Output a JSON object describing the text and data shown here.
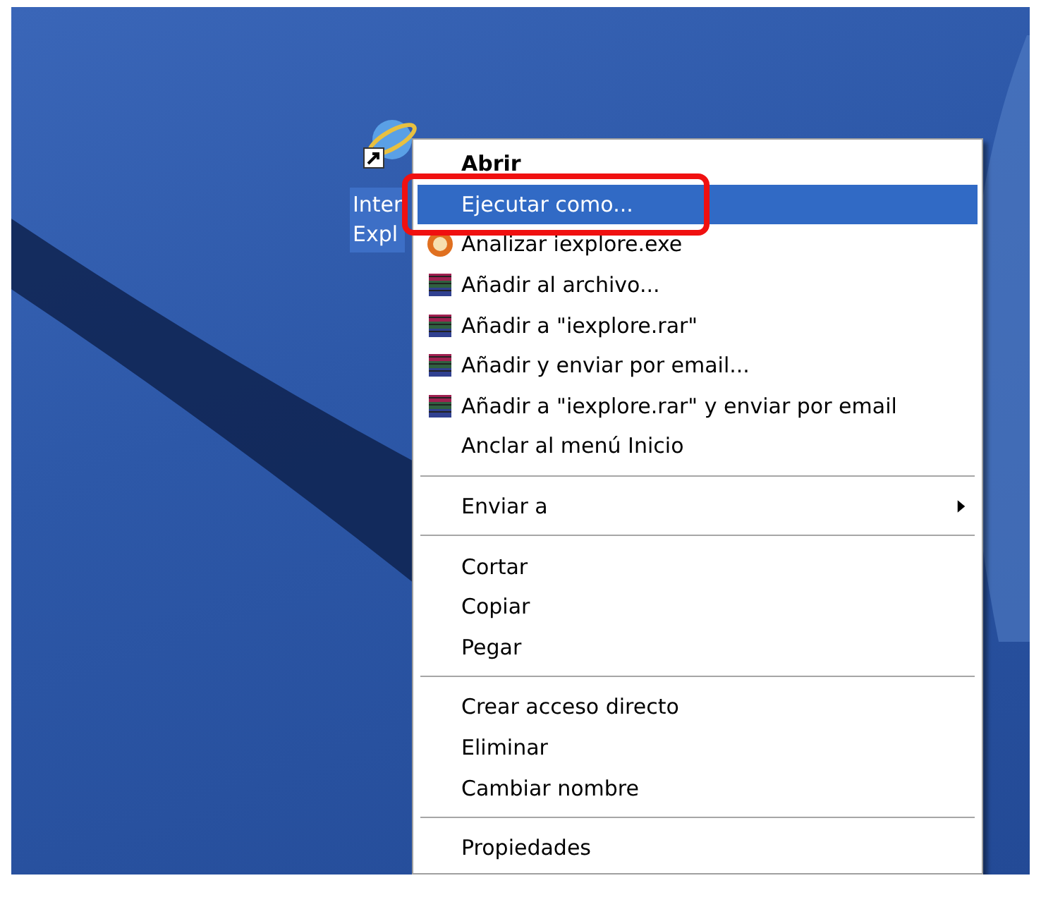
{
  "desktop_icon": {
    "label_lines": [
      "Inter",
      "Expl"
    ],
    "selected": true
  },
  "context_menu": {
    "groups": [
      {
        "items": [
          {
            "label": "Abrir",
            "kind": "plain",
            "default": true,
            "selected": false
          },
          {
            "label": "Ejecutar como...",
            "kind": "plain",
            "default": false,
            "selected": true
          },
          {
            "label": "Analizar iexplore.exe",
            "kind": "scan",
            "default": false,
            "selected": false
          },
          {
            "label": "Añadir al archivo...",
            "kind": "archive",
            "default": false,
            "selected": false
          },
          {
            "label": "Añadir a \"iexplore.rar\"",
            "kind": "archive",
            "default": false,
            "selected": false
          },
          {
            "label": "Añadir y enviar por email...",
            "kind": "archive",
            "default": false,
            "selected": false
          },
          {
            "label": "Añadir a \"iexplore.rar\" y enviar por email",
            "kind": "archive",
            "default": false,
            "selected": false
          },
          {
            "label": "Anclar al menú Inicio",
            "kind": "plain",
            "default": false,
            "selected": false
          }
        ]
      },
      {
        "items": [
          {
            "label": "Enviar a",
            "kind": "submenu",
            "default": false,
            "selected": false
          }
        ]
      },
      {
        "items": [
          {
            "label": "Cortar",
            "kind": "plain",
            "default": false,
            "selected": false
          },
          {
            "label": "Copiar",
            "kind": "plain",
            "default": false,
            "selected": false
          },
          {
            "label": "Pegar",
            "kind": "plain",
            "default": false,
            "selected": false
          }
        ]
      },
      {
        "items": [
          {
            "label": "Crear acceso directo",
            "kind": "plain",
            "default": false,
            "selected": false
          },
          {
            "label": "Eliminar",
            "kind": "plain",
            "default": false,
            "selected": false
          },
          {
            "label": "Cambiar nombre",
            "kind": "plain",
            "default": false,
            "selected": false
          }
        ]
      },
      {
        "items": [
          {
            "label": "Propiedades",
            "kind": "plain",
            "default": false,
            "selected": false
          }
        ]
      }
    ]
  }
}
